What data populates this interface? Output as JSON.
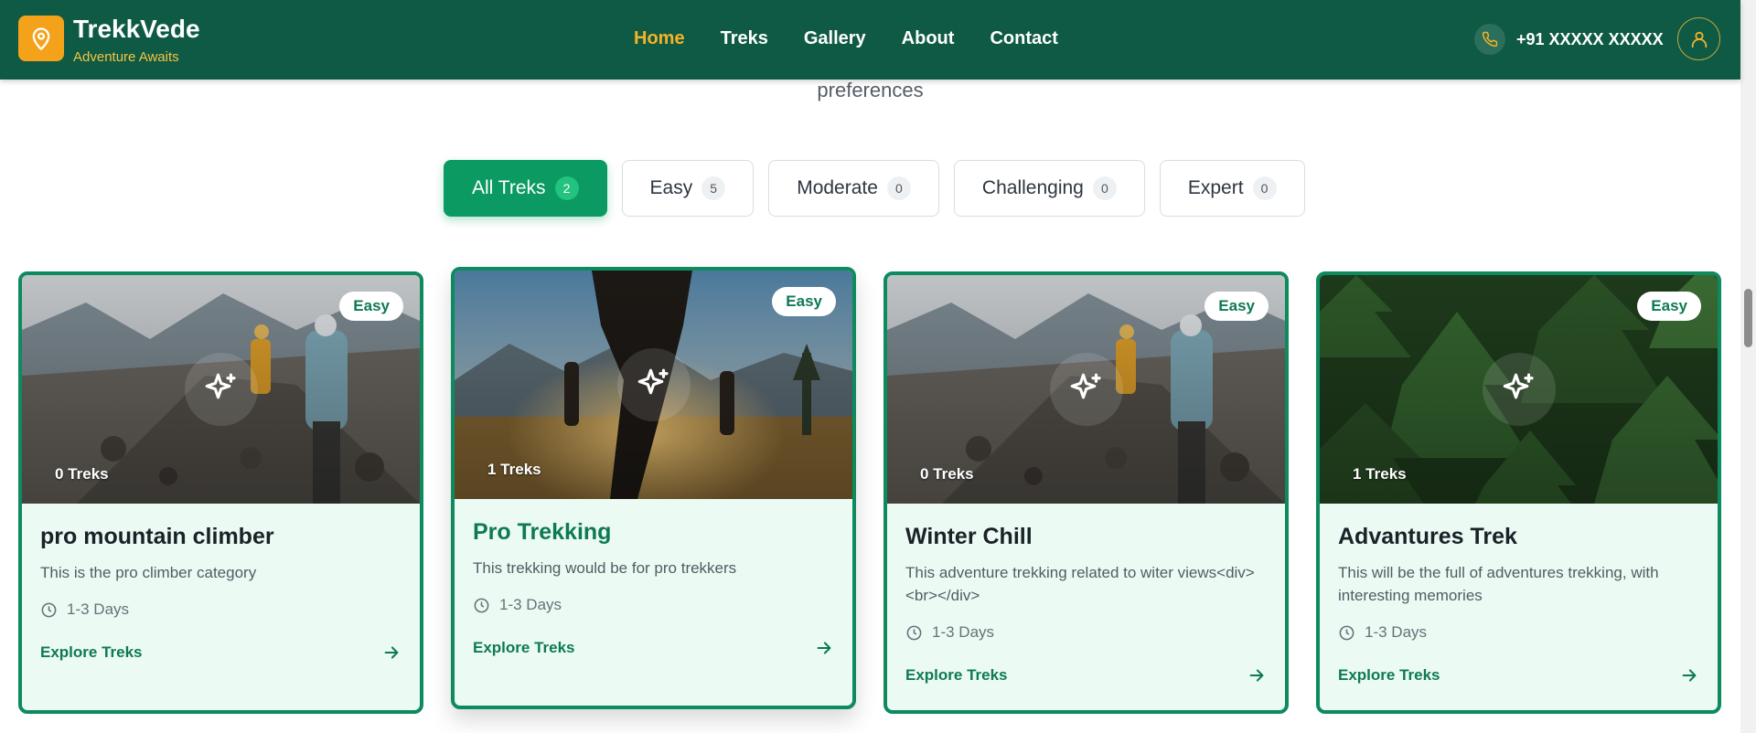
{
  "header": {
    "brand": "TrekkVede",
    "tagline": "Adventure Awaits",
    "nav": [
      {
        "label": "Home",
        "active": true
      },
      {
        "label": "Treks",
        "active": false
      },
      {
        "label": "Gallery",
        "active": false
      },
      {
        "label": "About",
        "active": false
      },
      {
        "label": "Contact",
        "active": false
      }
    ],
    "phone": "+91 XXXXX XXXXX",
    "colors": {
      "background": "#0e5a45",
      "accent": "#f5b325",
      "logo": "#f5a21b"
    }
  },
  "section": {
    "subtitle": "preferences"
  },
  "filters": [
    {
      "label": "All Treks",
      "count": "2",
      "active": true
    },
    {
      "label": "Easy",
      "count": "5",
      "active": false
    },
    {
      "label": "Moderate",
      "count": "0",
      "active": false
    },
    {
      "label": "Challenging",
      "count": "0",
      "active": false
    },
    {
      "label": "Expert",
      "count": "0",
      "active": false
    }
  ],
  "cards": [
    {
      "badge": "Easy",
      "trek_count": "0 Treks",
      "title": "pro mountain climber",
      "description": "This is the pro climber category",
      "duration": "1-3 Days",
      "cta": "Explore Treks",
      "image": "rocky-trail"
    },
    {
      "badge": "Easy",
      "trek_count": "1 Treks",
      "title": "Pro Trekking",
      "description": "This trekking would be for pro trekkers",
      "duration": "1-3 Days",
      "cta": "Explore Treks",
      "image": "sunset-hikers"
    },
    {
      "badge": "Easy",
      "trek_count": "0 Treks",
      "title": "Winter Chill",
      "description": "This adventure trekking related to witer views<div><br></div>",
      "duration": "1-3 Days",
      "cta": "Explore Treks",
      "image": "rocky-trail"
    },
    {
      "badge": "Easy",
      "trek_count": "1 Treks",
      "title": "Advantures Trek",
      "description": "This will be the full of adventures trekking, with interesting memories",
      "duration": "1-3 Days",
      "cta": "Explore Treks",
      "image": "pine-forest"
    }
  ],
  "icons": {
    "logo": "map-pin-icon",
    "phone": "phone-icon",
    "user": "user-icon",
    "card_center": "sparkle-icon",
    "duration": "clock-icon",
    "cta": "arrow-right-icon"
  }
}
